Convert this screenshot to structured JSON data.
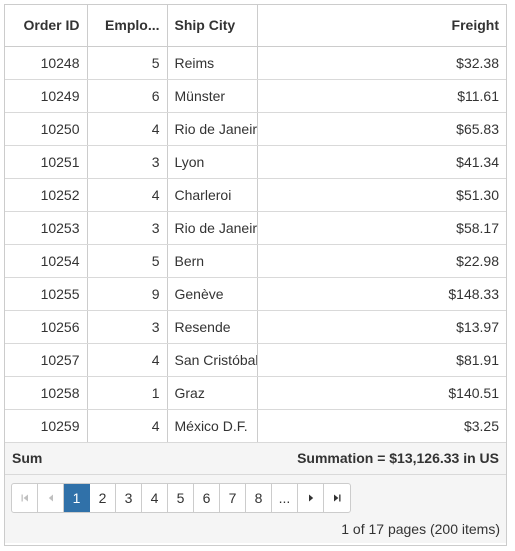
{
  "columns": {
    "order_id": "Order ID",
    "employee": "Emplo...",
    "ship_city": "Ship City",
    "freight": "Freight"
  },
  "rows": [
    {
      "order_id": "10248",
      "employee": "5",
      "ship_city": "Reims",
      "freight": "$32.38"
    },
    {
      "order_id": "10249",
      "employee": "6",
      "ship_city": "Münster",
      "freight": "$11.61"
    },
    {
      "order_id": "10250",
      "employee": "4",
      "ship_city": "Rio de Janeiro",
      "freight": "$65.83"
    },
    {
      "order_id": "10251",
      "employee": "3",
      "ship_city": "Lyon",
      "freight": "$41.34"
    },
    {
      "order_id": "10252",
      "employee": "4",
      "ship_city": "Charleroi",
      "freight": "$51.30"
    },
    {
      "order_id": "10253",
      "employee": "3",
      "ship_city": "Rio de Janeiro",
      "freight": "$58.17"
    },
    {
      "order_id": "10254",
      "employee": "5",
      "ship_city": "Bern",
      "freight": "$22.98"
    },
    {
      "order_id": "10255",
      "employee": "9",
      "ship_city": "Genève",
      "freight": "$148.33"
    },
    {
      "order_id": "10256",
      "employee": "3",
      "ship_city": "Resende",
      "freight": "$13.97"
    },
    {
      "order_id": "10257",
      "employee": "4",
      "ship_city": "San Cristóbal",
      "freight": "$81.91"
    },
    {
      "order_id": "10258",
      "employee": "1",
      "ship_city": "Graz",
      "freight": "$140.51"
    },
    {
      "order_id": "10259",
      "employee": "4",
      "ship_city": "México D.F.",
      "freight": "$3.25"
    }
  ],
  "footer": {
    "label": "Sum",
    "summary": "Summation = $13,126.33 in US"
  },
  "pager": {
    "pages": [
      "1",
      "2",
      "3",
      "4",
      "5",
      "6",
      "7",
      "8",
      "..."
    ],
    "current": "1",
    "info": "1 of 17 pages (200 items)"
  },
  "colors": {
    "active_page": "#3071a9",
    "border": "#cccccc",
    "footer_bg": "#f5f5f5"
  }
}
